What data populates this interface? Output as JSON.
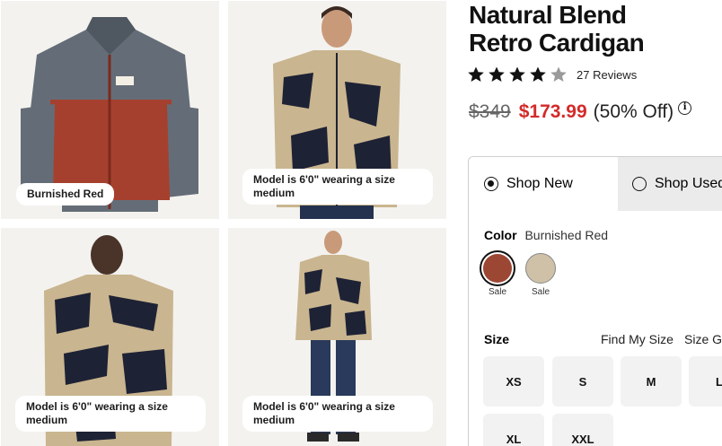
{
  "gallery": [
    {
      "caption": "Burnished Red"
    },
    {
      "caption": "Model is 6'0\" wearing a size medium"
    },
    {
      "caption": "Model is 6'0\" wearing a size medium"
    },
    {
      "caption": "Model is 6'0\" wearing a size medium"
    }
  ],
  "product": {
    "title_line1": "Natural Blend",
    "title_line2": "Retro Cardigan",
    "rating": 4.5,
    "reviews": "27 Reviews",
    "original_price": "$349",
    "sale_price": "$173.99",
    "discount": "(50% Off)",
    "info_icon": "i"
  },
  "purchase": {
    "tab_new": "Shop New",
    "tab_used": "Shop Used",
    "color_label": "Color",
    "color_value": "Burnished Red",
    "swatches": [
      {
        "name": "Burnished Red",
        "color": "#9c4634",
        "badge": "Sale"
      },
      {
        "name": "Tan",
        "color": "#cfc1a8",
        "badge": "Sale"
      }
    ],
    "size_label": "Size",
    "find_my_size": "Find My Size",
    "size_guide": "Size Guide",
    "sizes": [
      "XS",
      "S",
      "M",
      "L",
      "XL",
      "XXL"
    ]
  },
  "colors": {
    "sale": "#d42a2a",
    "jacket_red": "#a6402e",
    "jacket_gray": "#5e6670",
    "pattern_navy": "#1e2235",
    "pattern_tan": "#c9b58f"
  }
}
